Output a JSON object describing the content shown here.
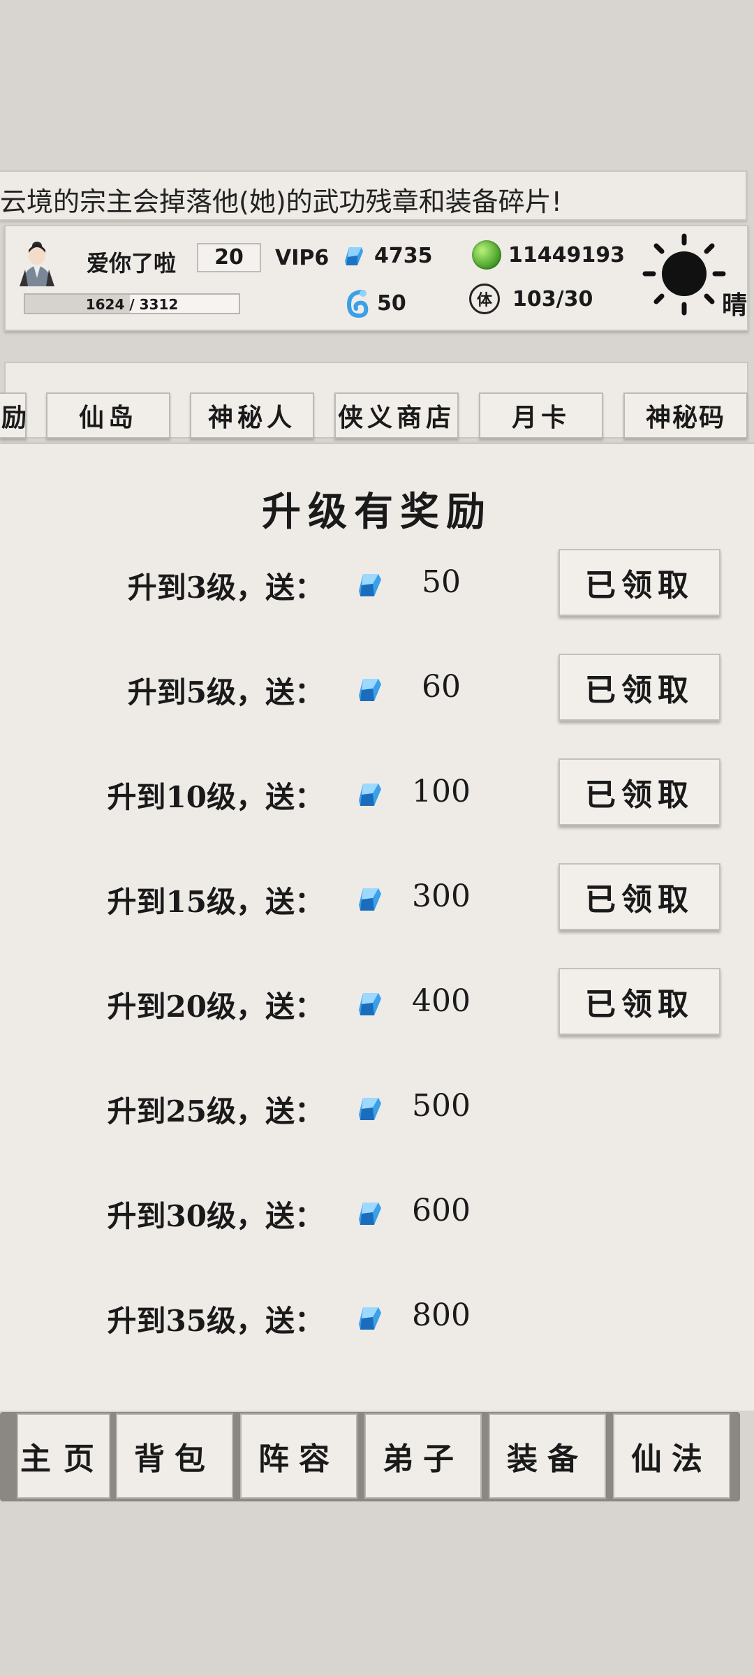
{
  "marquee": {
    "text": "云境的宗主会掉落他(她)的武功残章和装备碎片!"
  },
  "player": {
    "name": "爱你了啦",
    "level": "20",
    "vip": "VIP6",
    "xp_text": "1624 / 3312",
    "xp_fraction": 0.49
  },
  "resources": {
    "gems": "4735",
    "coins": "11449193",
    "orbs": "50",
    "stamina": "103/30",
    "stamina_icon_glyph": "体"
  },
  "weather": {
    "label": "晴",
    "icon": "sun-icon"
  },
  "tabs": [
    {
      "label": "励"
    },
    {
      "label": "仙岛"
    },
    {
      "label": "神秘人"
    },
    {
      "label": "侠义商店"
    },
    {
      "label": "月卡"
    },
    {
      "label": "神秘码"
    }
  ],
  "main": {
    "title": "升级有奖励",
    "claimed_label": "已领取",
    "rewards": [
      {
        "label": "升到3级，送：",
        "amount": "50",
        "claimed": true
      },
      {
        "label": "升到5级，送：",
        "amount": "60",
        "claimed": true
      },
      {
        "label": "升到10级，送：",
        "amount": "100",
        "claimed": true
      },
      {
        "label": "升到15级，送：",
        "amount": "300",
        "claimed": true
      },
      {
        "label": "升到20级，送：",
        "amount": "400",
        "claimed": true
      },
      {
        "label": "升到25级，送：",
        "amount": "500",
        "claimed": false
      },
      {
        "label": "升到30级，送：",
        "amount": "600",
        "claimed": false
      },
      {
        "label": "升到35级，送：",
        "amount": "800",
        "claimed": false
      }
    ]
  },
  "nav": [
    {
      "label": "主页"
    },
    {
      "label": "背包"
    },
    {
      "label": "阵容"
    },
    {
      "label": "弟子"
    },
    {
      "label": "装备"
    },
    {
      "label": "仙法"
    }
  ],
  "colors": {
    "gem": "#3aa0e8",
    "coin": "#3f9a22",
    "panel": "#eeebe7"
  }
}
